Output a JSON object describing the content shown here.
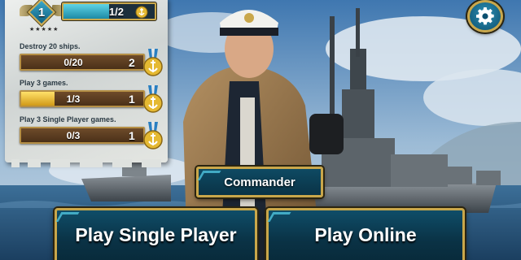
{
  "player": {
    "rank": "1",
    "xp_text": "1/2",
    "xp_progress": 0.5
  },
  "missions": [
    {
      "label": "Destroy 20 ships.",
      "progress_text": "0/20",
      "progress": 0.0,
      "reward": "2"
    },
    {
      "label": "Play 3 games.",
      "progress_text": "1/3",
      "progress": 0.333,
      "reward": "1"
    },
    {
      "label": "Play 3 Single Player games.",
      "progress_text": "0/3",
      "progress": 0.0,
      "reward": "1"
    }
  ],
  "buttons": {
    "commander": "Commander",
    "play_single": "Play Single Player",
    "play_online": "Play Online"
  },
  "icons": {
    "settings": "gear-icon",
    "medal": "anchor-medal-icon",
    "rank": "rank-diamond-icon"
  },
  "colors": {
    "gold_border": "#c9a74b",
    "button_blue": "#0a3346",
    "xp_fill": "#5fd4e6",
    "mission_fill": "#ffe16a"
  }
}
